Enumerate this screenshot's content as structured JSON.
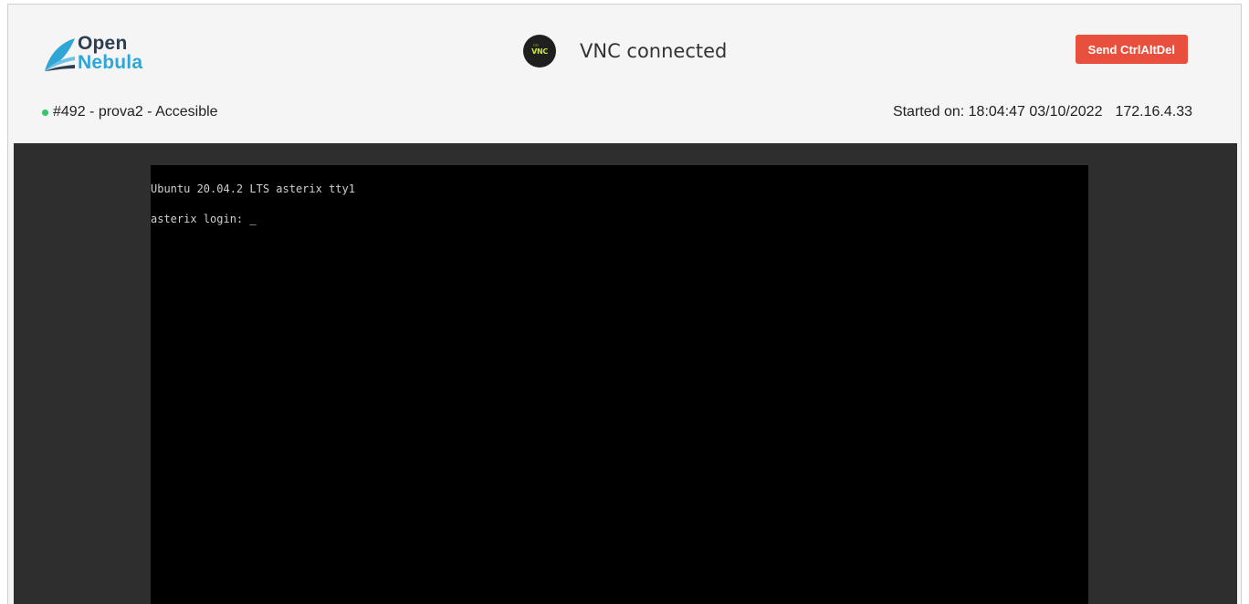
{
  "header": {
    "logo": {
      "line1": "Open",
      "line2": "Nebula",
      "brand_dark": "#2c3e50",
      "brand_blue": "#2fa6d6"
    },
    "vnc_icon": "novnc-logo-icon",
    "vnc_logo_small": "no",
    "vnc_logo_big": "VNC",
    "vnc_status": "VNC connected",
    "send_ctrl_alt_del": "Send CtrlAltDel",
    "button_color": "#e8503d"
  },
  "vm": {
    "status_color": "#36c46a",
    "label": "#492 - prova2 - Accesible",
    "started_on": "Started on: 18:04:47 03/10/2022",
    "ip": "172.16.4.33"
  },
  "terminal": {
    "line1": "Ubuntu 20.04.2 LTS asterix tty1",
    "prompt": "asterix login: ",
    "cursor": "_"
  }
}
